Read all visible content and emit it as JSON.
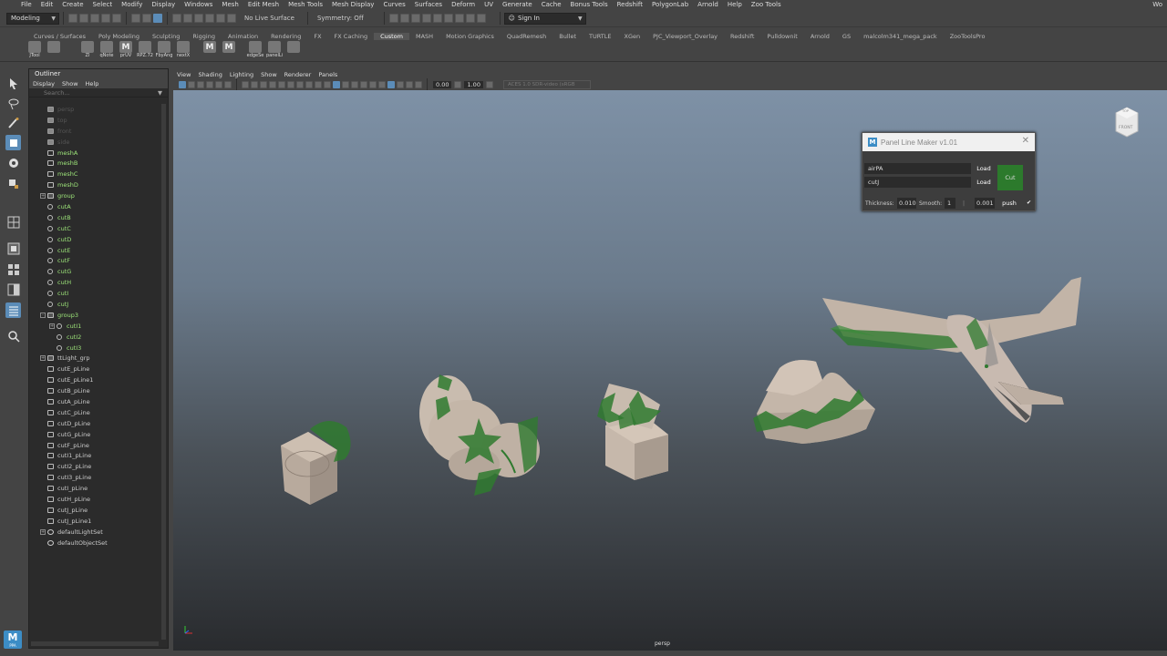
{
  "menubar": {
    "items": [
      "File",
      "Edit",
      "Create",
      "Select",
      "Modify",
      "Display",
      "Windows",
      "Mesh",
      "Edit Mesh",
      "Mesh Tools",
      "Mesh Display",
      "Curves",
      "Surfaces",
      "Deform",
      "UV",
      "Generate",
      "Cache",
      "Bonus Tools",
      "Redshift",
      "PolygonLab",
      "Arnold",
      "Help",
      "Zoo Tools"
    ],
    "right": "Wo"
  },
  "statusline": {
    "menuset": "Modeling",
    "live_surface": "No Live Surface",
    "symmetry": "Symmetry: Off",
    "sign_in": "Sign In"
  },
  "shelf": {
    "tabs": [
      "Curves / Surfaces",
      "Poly Modeling",
      "Sculpting",
      "Rigging",
      "Animation",
      "Rendering",
      "FX",
      "FX Caching",
      "Custom",
      "MASH",
      "Motion Graphics",
      "QuadRemesh",
      "Bullet",
      "TURTLE",
      "XGen",
      "PJC_Viewport_Overlay",
      "Redshift",
      "Pulldownit",
      "Arnold",
      "GS",
      "malcolm341_mega_pack",
      "ZooToolsPro"
    ],
    "active_tab": "Custom",
    "buttons": [
      {
        "icon": "",
        "label": "JTool"
      },
      {
        "icon": "",
        "label": ""
      },
      {
        "icon": "",
        "label": "ZI"
      },
      {
        "icon": "",
        "label": "qNote"
      },
      {
        "icon": "M",
        "label": "prUV"
      },
      {
        "icon": "",
        "label": "RPZ.72"
      },
      {
        "icon": "",
        "label": "FbyAng"
      },
      {
        "icon": "",
        "label": "nextX"
      },
      {
        "icon": "M",
        "label": ""
      },
      {
        "icon": "M",
        "label": ""
      },
      {
        "icon": "",
        "label": "edgeSe"
      },
      {
        "icon": "",
        "label": "panelLi"
      },
      {
        "icon": "",
        "label": ""
      }
    ]
  },
  "outliner": {
    "title": "Outliner",
    "menu": [
      "Display",
      "Show",
      "Help"
    ],
    "search_placeholder": "Search...",
    "items": [
      {
        "label": "persp",
        "indent": 0,
        "type": "cam",
        "color": "dim",
        "exp": ""
      },
      {
        "label": "top",
        "indent": 0,
        "type": "cam",
        "color": "dim",
        "exp": ""
      },
      {
        "label": "front",
        "indent": 0,
        "type": "cam",
        "color": "dim",
        "exp": ""
      },
      {
        "label": "side",
        "indent": 0,
        "type": "cam",
        "color": "dim",
        "exp": ""
      },
      {
        "label": "meshA",
        "indent": 0,
        "type": "mesh",
        "color": "grn",
        "exp": ""
      },
      {
        "label": "meshB",
        "indent": 0,
        "type": "mesh",
        "color": "grn",
        "exp": ""
      },
      {
        "label": "meshC",
        "indent": 0,
        "type": "mesh",
        "color": "grn",
        "exp": ""
      },
      {
        "label": "meshD",
        "indent": 0,
        "type": "mesh",
        "color": "grn",
        "exp": ""
      },
      {
        "label": "group",
        "indent": 0,
        "type": "grp",
        "color": "grn",
        "exp": "+"
      },
      {
        "label": "cutA",
        "indent": 0,
        "type": "cv",
        "color": "grn",
        "exp": ""
      },
      {
        "label": "cutB",
        "indent": 0,
        "type": "cv",
        "color": "grn",
        "exp": ""
      },
      {
        "label": "cutC",
        "indent": 0,
        "type": "cv",
        "color": "grn",
        "exp": ""
      },
      {
        "label": "cutD",
        "indent": 0,
        "type": "cv",
        "color": "grn",
        "exp": ""
      },
      {
        "label": "cutE",
        "indent": 0,
        "type": "cv",
        "color": "grn",
        "exp": ""
      },
      {
        "label": "cutF",
        "indent": 0,
        "type": "cv",
        "color": "grn",
        "exp": ""
      },
      {
        "label": "cutG",
        "indent": 0,
        "type": "cv",
        "color": "grn",
        "exp": ""
      },
      {
        "label": "cutH",
        "indent": 0,
        "type": "cv",
        "color": "grn",
        "exp": ""
      },
      {
        "label": "cutI",
        "indent": 0,
        "type": "cv",
        "color": "grn",
        "exp": ""
      },
      {
        "label": "cutJ",
        "indent": 0,
        "type": "cv",
        "color": "grn",
        "exp": ""
      },
      {
        "label": "group3",
        "indent": 0,
        "type": "grp",
        "color": "grn",
        "exp": "-"
      },
      {
        "label": "cutI1",
        "indent": 1,
        "type": "cv",
        "color": "grn",
        "exp": "+"
      },
      {
        "label": "cutI2",
        "indent": 1,
        "type": "cv",
        "color": "grn",
        "exp": ""
      },
      {
        "label": "cutI3",
        "indent": 1,
        "type": "cv",
        "color": "grn",
        "exp": ""
      },
      {
        "label": "ttLight_grp",
        "indent": 0,
        "type": "grp",
        "color": "wht",
        "exp": "+"
      },
      {
        "label": "cutE_pLine",
        "indent": 0,
        "type": "mesh",
        "color": "wht",
        "exp": ""
      },
      {
        "label": "cutE_pLine1",
        "indent": 0,
        "type": "mesh",
        "color": "wht",
        "exp": ""
      },
      {
        "label": "cutB_pLine",
        "indent": 0,
        "type": "mesh",
        "color": "wht",
        "exp": ""
      },
      {
        "label": "cutA_pLine",
        "indent": 0,
        "type": "mesh",
        "color": "wht",
        "exp": ""
      },
      {
        "label": "cutC_pLine",
        "indent": 0,
        "type": "mesh",
        "color": "wht",
        "exp": ""
      },
      {
        "label": "cutD_pLine",
        "indent": 0,
        "type": "mesh",
        "color": "wht",
        "exp": ""
      },
      {
        "label": "cutG_pLine",
        "indent": 0,
        "type": "mesh",
        "color": "wht",
        "exp": ""
      },
      {
        "label": "cutF_pLine",
        "indent": 0,
        "type": "mesh",
        "color": "wht",
        "exp": ""
      },
      {
        "label": "cutI1_pLine",
        "indent": 0,
        "type": "mesh",
        "color": "wht",
        "exp": ""
      },
      {
        "label": "cutI2_pLine",
        "indent": 0,
        "type": "mesh",
        "color": "wht",
        "exp": ""
      },
      {
        "label": "cutI3_pLine",
        "indent": 0,
        "type": "mesh",
        "color": "wht",
        "exp": ""
      },
      {
        "label": "cutI_pLine",
        "indent": 0,
        "type": "mesh",
        "color": "wht",
        "exp": ""
      },
      {
        "label": "cutH_pLine",
        "indent": 0,
        "type": "mesh",
        "color": "wht",
        "exp": ""
      },
      {
        "label": "cutJ_pLine",
        "indent": 0,
        "type": "mesh",
        "color": "wht",
        "exp": ""
      },
      {
        "label": "cutJ_pLine1",
        "indent": 0,
        "type": "mesh",
        "color": "wht",
        "exp": ""
      },
      {
        "label": "defaultLightSet",
        "indent": 0,
        "type": "set",
        "color": "wht",
        "exp": "+"
      },
      {
        "label": "defaultObjectSet",
        "indent": 0,
        "type": "set",
        "color": "wht",
        "exp": ""
      }
    ]
  },
  "viewport": {
    "menu": [
      "View",
      "Shading",
      "Lighting",
      "Show",
      "Renderer",
      "Panels"
    ],
    "field_a": "0.00",
    "field_b": "1.00",
    "colorspace": "ACES 1.0 SDR-video (sRGB",
    "camera_label": "persp",
    "viewcube_top": "TOP",
    "viewcube_front": "FRONT"
  },
  "panel_line_maker": {
    "title": "Panel Line Maker v1.01",
    "field1": "airPA",
    "field2": "cutJ",
    "load_label": "Load",
    "cut_label": "Cut",
    "thickness_label": "Thickness:",
    "thickness": "0.010",
    "smooth_label": "Smooth:",
    "smooth": "1",
    "divider": "|",
    "push_value": "0.001",
    "push_label": "push",
    "check": "✔"
  },
  "logo": {
    "letter": "M",
    "sub": "PPA"
  },
  "colors": {
    "accent": "#5b8cb8",
    "panel_green": "#2c7a2c",
    "cut_green": "#2f7a2f",
    "model_beige": "#c8b8a8"
  }
}
